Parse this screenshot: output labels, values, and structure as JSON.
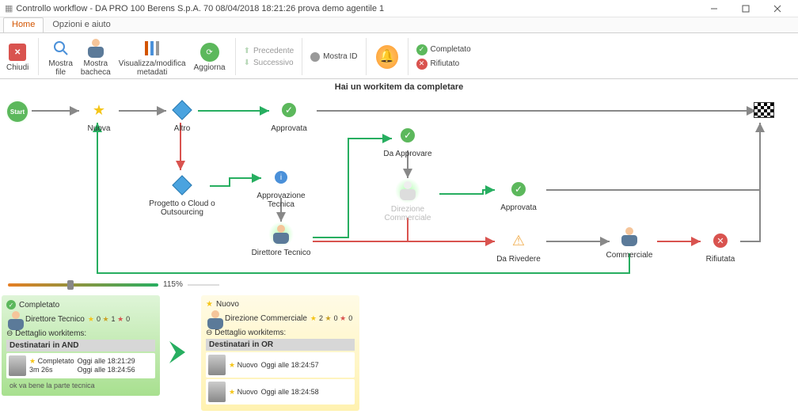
{
  "window": {
    "title": "Controllo workflow - DA PRO 100 Berens S.p.A. 70 08/04/2018 18:21:26 prova demo agentile 1"
  },
  "tabs": {
    "home": "Home",
    "options": "Opzioni e aiuto"
  },
  "ribbon": {
    "chiudi": "Chiudi",
    "mostra_file": "Mostra\nfile",
    "mostra_bacheca": "Mostra\nbacheca",
    "visualizza": "Visualizza/modifica\nmetadati",
    "aggiorna": "Aggiorna",
    "precedente": "Precedente",
    "successivo": "Successivo",
    "mostra_id": "Mostra ID",
    "completato": "Completato",
    "rifiutato": "Rifiutato"
  },
  "banner": "Hai un workitem da completare",
  "nodes": {
    "start": "Start",
    "nuova": "Nuova",
    "altro": "Altro",
    "approvata1": "Approvata",
    "progetto": "Progetto o Cloud o Outsourcing",
    "approv_tecnica": "Approvazione Tecnica",
    "direttore_tecnico": "Direttore Tecnico",
    "da_approvare": "Da Approvare",
    "dir_commerciale": "Direzione Commerciale",
    "approvata2": "Approvata",
    "da_rivedere": "Da Rivedere",
    "commerciale": "Commerciale",
    "rifiutata": "Rifiutata"
  },
  "zoom": "115%",
  "cards": [
    {
      "role": "Direttore Tecnico",
      "status": "Completato",
      "stats": {
        "star": "0",
        "gold": "1",
        "red": "0"
      },
      "detail": "Dettaglio workitems:",
      "dest": "Destinatari in AND",
      "rows": [
        {
          "status": "Completato",
          "dur": "3m 26s",
          "t1": "Oggi alle 18:21:29",
          "t2": "Oggi alle 18:24:56"
        }
      ],
      "comment": "ok va bene la parte tecnica"
    },
    {
      "role": "Direzione Commerciale",
      "status": "Nuovo",
      "stats": {
        "star": "2",
        "gold": "0",
        "red": "0"
      },
      "detail": "Dettaglio workitems:",
      "dest": "Destinatari in OR",
      "rows": [
        {
          "status": "Nuovo",
          "t1": "Oggi alle 18:24:57"
        },
        {
          "status": "Nuovo",
          "t1": "Oggi alle 18:24:58"
        }
      ]
    }
  ]
}
